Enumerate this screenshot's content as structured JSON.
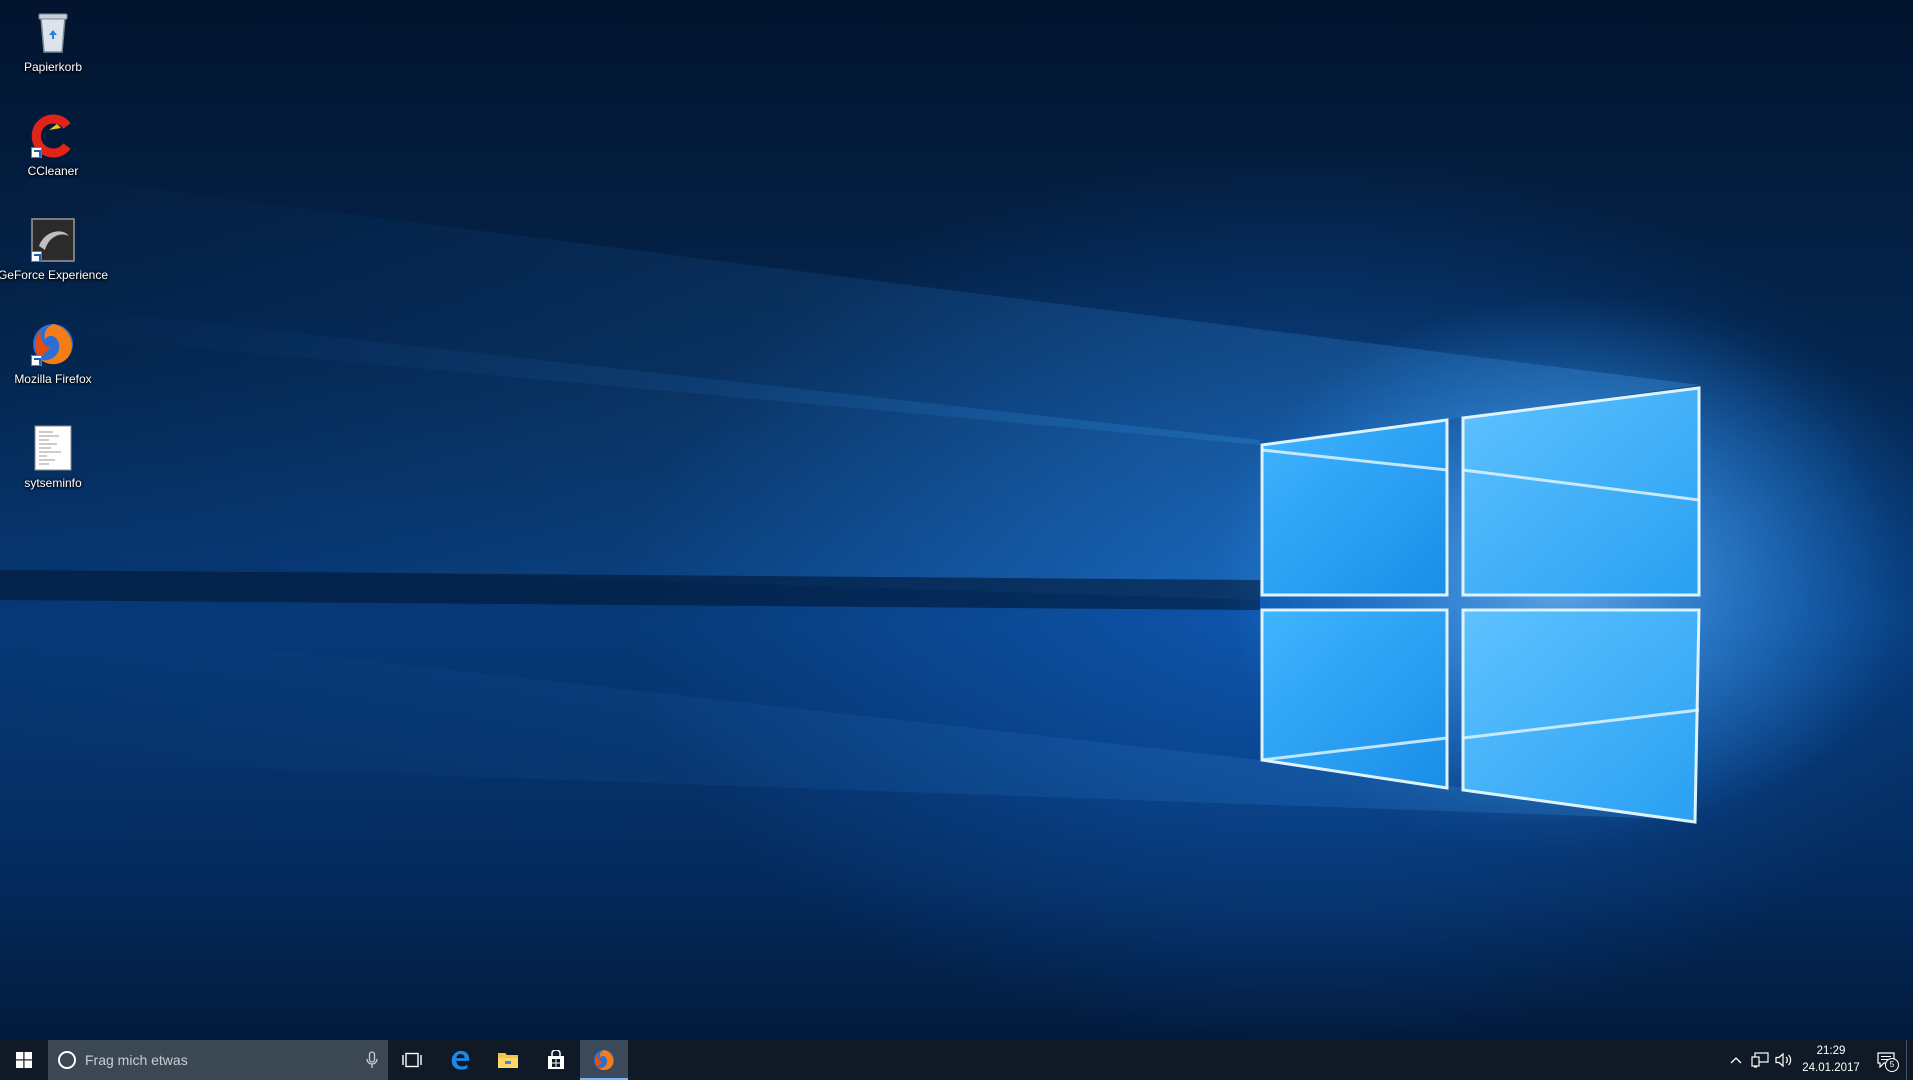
{
  "desktop": {
    "icons": [
      {
        "label": "Papierkorb",
        "icon": "recycle-bin-icon"
      },
      {
        "label": "CCleaner",
        "icon": "ccleaner-icon"
      },
      {
        "label": "GeForce Experience",
        "icon": "geforce-experience-icon"
      },
      {
        "label": "Mozilla Firefox",
        "icon": "firefox-icon"
      },
      {
        "label": "sytseminfo",
        "icon": "text-document-icon"
      }
    ]
  },
  "taskbar": {
    "search": {
      "placeholder": "Frag mich etwas"
    },
    "pinned": [
      {
        "name": "task-view",
        "icon": "task-view-icon"
      },
      {
        "name": "edge",
        "icon": "edge-icon"
      },
      {
        "name": "file-explorer",
        "icon": "folder-icon"
      },
      {
        "name": "store",
        "icon": "store-icon"
      },
      {
        "name": "firefox",
        "icon": "firefox-icon",
        "active": true
      }
    ],
    "tray": {
      "time": "21:29",
      "date": "24.01.2017",
      "notifications": "5"
    }
  },
  "colors": {
    "taskbar": "#101a26",
    "search_box": "#3c4754",
    "active_indicator": "#78b6f2",
    "wallpaper_light": "#3aa6f5"
  }
}
